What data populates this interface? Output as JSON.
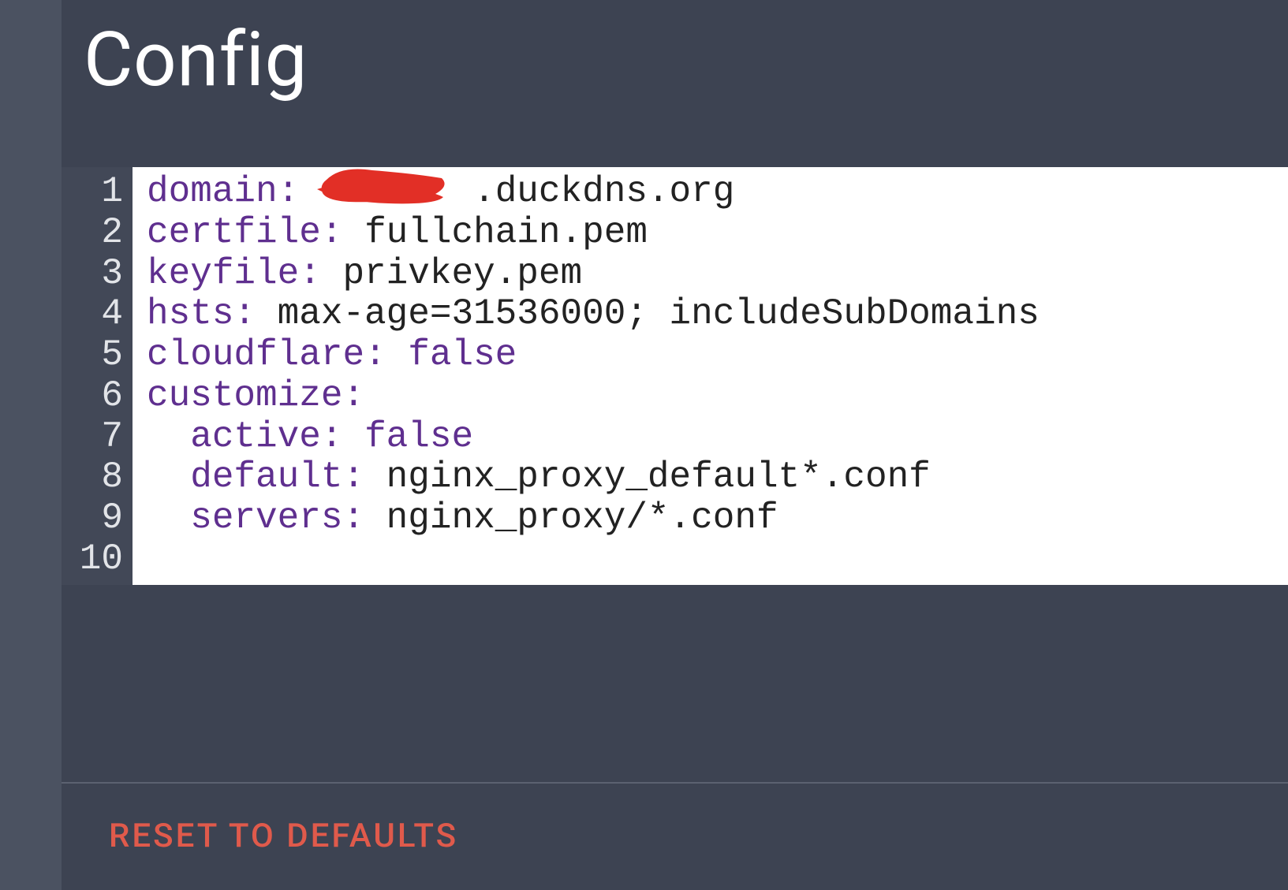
{
  "title": "Config",
  "colors": {
    "bg": "#3d4352",
    "gutter": "#424857",
    "key": "#5f2f8f",
    "reset": "#e05a4b",
    "redact": "#e22f26"
  },
  "editor": {
    "lines": [
      {
        "n": "1",
        "key": "domain",
        "sep": ": ",
        "val": "       .duckdns.org",
        "val_type": "plain",
        "redacted": true
      },
      {
        "n": "2",
        "key": "certfile",
        "sep": ": ",
        "val": "fullchain.pem",
        "val_type": "plain"
      },
      {
        "n": "3",
        "key": "keyfile",
        "sep": ": ",
        "val": "privkey.pem",
        "val_type": "plain"
      },
      {
        "n": "4",
        "key": "hsts",
        "sep": ": ",
        "val": "max-age=31536000; includeSubDomains",
        "val_type": "plain"
      },
      {
        "n": "5",
        "key": "cloudflare",
        "sep": ": ",
        "val": "false",
        "val_type": "bool"
      },
      {
        "n": "6",
        "key": "customize",
        "sep": ":",
        "val": "",
        "val_type": "plain"
      },
      {
        "n": "7",
        "indent": "  ",
        "key": "active",
        "sep": ": ",
        "val": "false",
        "val_type": "bool"
      },
      {
        "n": "8",
        "indent": "  ",
        "key": "default",
        "sep": ": ",
        "val": "nginx_proxy_default*.conf",
        "val_type": "plain"
      },
      {
        "n": "9",
        "indent": "  ",
        "key": "servers",
        "sep": ": ",
        "val": "nginx_proxy/*.conf",
        "val_type": "plain"
      },
      {
        "n": "10",
        "key": "",
        "sep": "",
        "val": "",
        "val_type": "plain"
      }
    ]
  },
  "reset_label": "RESET TO DEFAULTS"
}
